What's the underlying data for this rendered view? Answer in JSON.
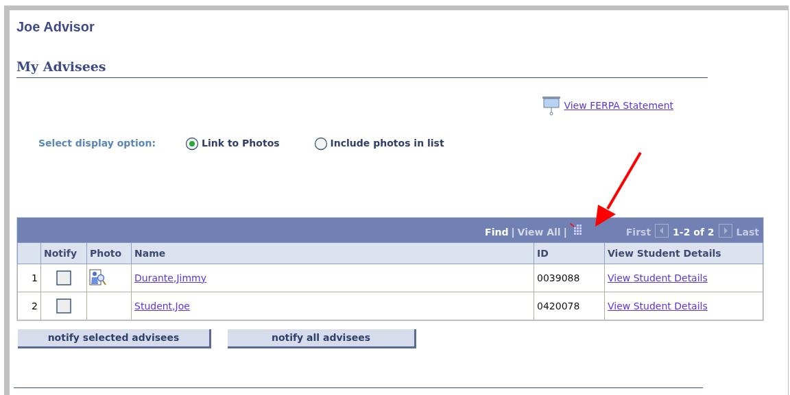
{
  "user_name": "Joe Advisor",
  "section_title": "My Advisees",
  "ferpa_link": "View FERPA Statement",
  "display_option": {
    "label": "Select display option:",
    "options": [
      {
        "label": "Link to Photos",
        "selected": true
      },
      {
        "label": "Include photos in list",
        "selected": false
      }
    ]
  },
  "grid": {
    "find": "Find",
    "separator_1": "|",
    "view_all": "View All",
    "separator_2": "|",
    "first": "First",
    "range": "1-2 of 2",
    "last": "Last",
    "columns": [
      "Notify",
      "Photo",
      "Name",
      "ID",
      "View Student Details"
    ],
    "rows": [
      {
        "number": "1",
        "checked": false,
        "photo": true,
        "name": "Durante,Jimmy",
        "id": "0039088",
        "details": "View Student Details"
      },
      {
        "number": "2",
        "checked": false,
        "photo": false,
        "name": "Student,Joe",
        "id": "0420078",
        "details": "View Student Details"
      }
    ]
  },
  "buttons": [
    "notify selected advisees",
    "notify all advisees"
  ]
}
